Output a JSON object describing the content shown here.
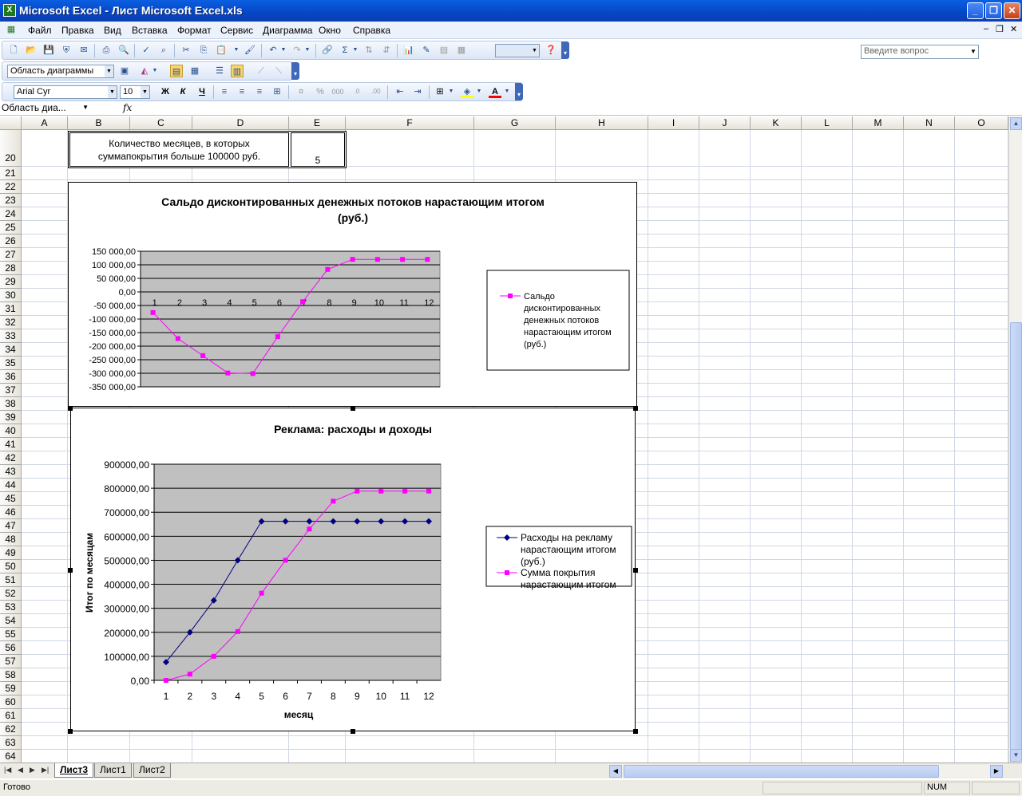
{
  "window": {
    "title": "Microsoft Excel - Лист Microsoft Excel.xls",
    "app_icon": "excel-icon"
  },
  "menu": {
    "items": [
      "Файл",
      "Правка",
      "Вид",
      "Вставка",
      "Формат",
      "Сервис",
      "Диаграмма",
      "Окно",
      "Справка"
    ],
    "help_placeholder": "Введите вопрос"
  },
  "chart_toolbar": {
    "object_select": "Область диаграммы"
  },
  "format_toolbar": {
    "font": "Arial Cyr",
    "size": "10",
    "bold": "Ж",
    "italic": "К",
    "underline": "Ч"
  },
  "formula_bar": {
    "name_box": "Область диа...",
    "fx": "fx"
  },
  "columns": [
    "A",
    "B",
    "C",
    "D",
    "E",
    "F",
    "G",
    "H",
    "I",
    "J",
    "K",
    "L",
    "M",
    "N",
    "O"
  ],
  "rows": [
    "20",
    "21",
    "22",
    "23",
    "24",
    "25",
    "26",
    "27",
    "28",
    "29",
    "30",
    "31",
    "32",
    "33",
    "34",
    "35",
    "36",
    "37",
    "38",
    "39",
    "40",
    "41",
    "42",
    "43",
    "44",
    "45",
    "46",
    "47",
    "48",
    "49",
    "50",
    "51",
    "52",
    "53",
    "54",
    "55",
    "56",
    "57",
    "58",
    "59",
    "60",
    "61",
    "62",
    "63",
    "64"
  ],
  "cells": {
    "label": "Количество месяцев, в которых суммапокрытия больше 100000 руб.",
    "label_line1": "Количество месяцев, в которых",
    "label_line2": "суммапокрытия больше 100000 руб.",
    "value": "5"
  },
  "chart_data": [
    {
      "type": "line",
      "title": "Сальдо дисконтированных денежных потоков нарастающим итогом (руб.)",
      "title_line1": "Сальдо дисконтированных денежных потоков нарастающим итогом",
      "title_line2": "(руб.)",
      "categories": [
        "1",
        "2",
        "3",
        "4",
        "5",
        "6",
        "7",
        "8",
        "9",
        "10",
        "11",
        "12"
      ],
      "y_ticks": [
        "150 000,00",
        "100 000,00",
        "50 000,00",
        "0,00",
        "-50 000,00",
        "-100 000,00",
        "-150 000,00",
        "-200 000,00",
        "-250 000,00",
        "-300 000,00",
        "-350 000,00"
      ],
      "ylim": [
        -350000,
        150000
      ],
      "series": [
        {
          "name": "Сальдо дисконтированных денежных потоков нарастающим итогом (руб.)",
          "color": "#ff00ff",
          "values": [
            -76000,
            -172000,
            -235000,
            -299000,
            -301000,
            -165000,
            -36000,
            83000,
            120000,
            120000,
            120000,
            120000
          ]
        }
      ],
      "legend_lines": [
        "Сальдо",
        "дисконтированных",
        "денежных потоков",
        "нарастающим итогом",
        "(руб.)"
      ],
      "legend": "right",
      "plot_background": "#c0c0c0"
    },
    {
      "type": "line",
      "title": "Реклама: расходы и доходы",
      "xlabel": "месяц",
      "ylabel": "Итог по месяцам",
      "categories": [
        "1",
        "2",
        "3",
        "4",
        "5",
        "6",
        "7",
        "8",
        "9",
        "10",
        "11",
        "12"
      ],
      "y_ticks": [
        "900000,00",
        "800000,00",
        "700000,00",
        "600000,00",
        "500000,00",
        "400000,00",
        "300000,00",
        "200000,00",
        "100000,00",
        "0,00"
      ],
      "ylim": [
        0,
        900000
      ],
      "series": [
        {
          "name": "Расходы на рекламу нарастающим итогом (руб.)",
          "color": "#000080",
          "values": [
            76000,
            200000,
            333000,
            500000,
            662000,
            662000,
            662000,
            662000,
            662000,
            662000,
            662000,
            662000
          ]
        },
        {
          "name": "Сумма покрытия нарастающим итогом",
          "color": "#ff00ff",
          "values": [
            0,
            26000,
            100000,
            203000,
            363000,
            500000,
            630000,
            746000,
            788000,
            788000,
            788000,
            788000
          ]
        }
      ],
      "legend_lines_1": [
        "Расходы на рекламу",
        "нарастающим итогом",
        "(руб.)"
      ],
      "legend_lines_2": [
        "Сумма покрытия",
        "нарастающим итогом"
      ],
      "legend": "right",
      "plot_background": "#c0c0c0"
    }
  ],
  "sheets": [
    "Лист3",
    "Лист1",
    "Лист2"
  ],
  "status": {
    "text": "Готово",
    "num": "NUM"
  }
}
